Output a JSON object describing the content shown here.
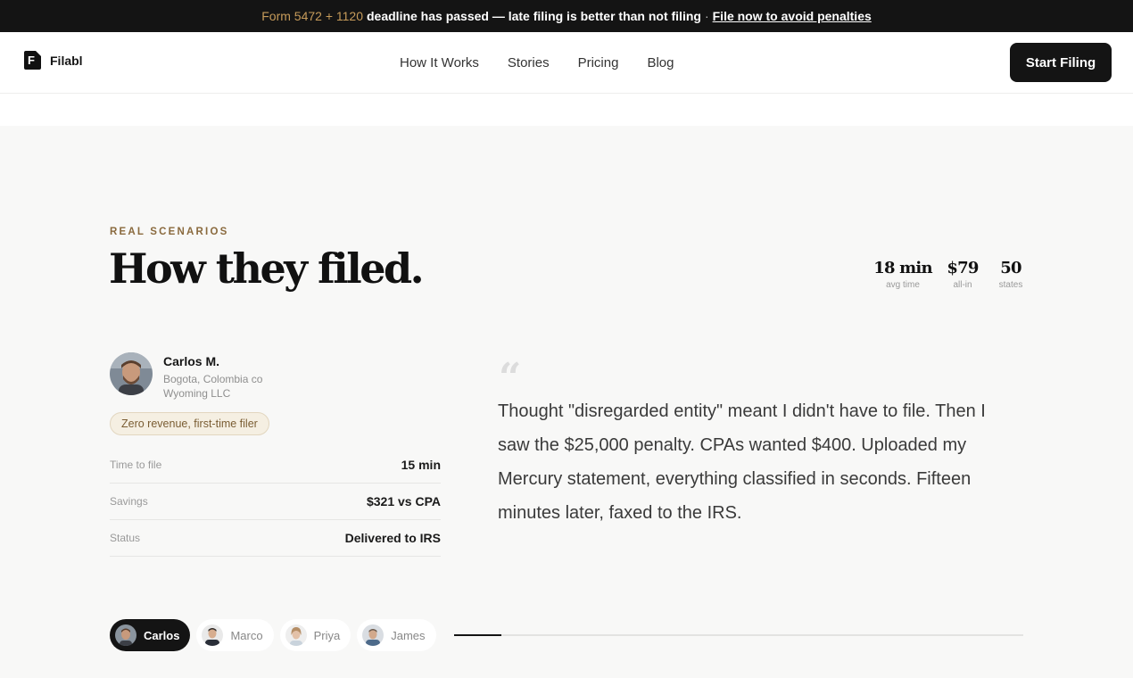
{
  "banner": {
    "form": "Form 5472 + 1120",
    "message": "deadline has passed — late filing is better than not filing",
    "separator": "·",
    "link": "File now to avoid penalties"
  },
  "nav": {
    "logo": "Filabl",
    "links": [
      "How It Works",
      "Stories",
      "Pricing",
      "Blog"
    ],
    "cta": "Start Filing"
  },
  "hero": {
    "eyebrow": "REAL SCENARIOS",
    "headline": "How they filed."
  },
  "stats": [
    {
      "value": "18 min",
      "label": "avg time"
    },
    {
      "value": "$79",
      "label": "all-in"
    },
    {
      "value": "50",
      "label": "states"
    }
  ],
  "story": {
    "name": "Carlos M.",
    "location": "Bogota, Colombia co",
    "company": "Wyoming LLC",
    "tag": "Zero revenue, first-time filer",
    "metrics": [
      {
        "key": "Time to file",
        "value": "15 min"
      },
      {
        "key": "Savings",
        "value": "$321 vs CPA"
      },
      {
        "key": "Status",
        "value": "Delivered to IRS"
      }
    ],
    "quote_mark": "“",
    "quote": "Thought \"disregarded entity\" meant I didn't have to file. Then I saw the $25,000 penalty. CPAs wanted $400. Uploaded my Mercury statement, everything classified in seconds. Fifteen minutes later, faxed to the IRS."
  },
  "tabs": [
    {
      "label": "Carlos",
      "active": true
    },
    {
      "label": "Marco",
      "active": false
    },
    {
      "label": "Priya",
      "active": false
    },
    {
      "label": "James",
      "active": false
    }
  ],
  "progress": {
    "fraction": 0.083
  },
  "colors": {
    "accent": "#c69b5a",
    "dark": "#141414",
    "tag_bg": "#f5efe2"
  }
}
